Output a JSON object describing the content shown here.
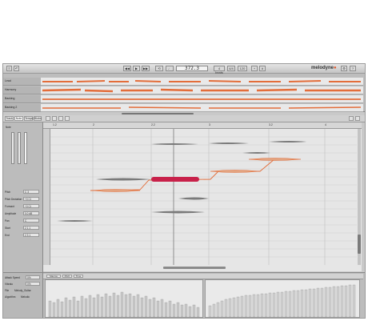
{
  "app": {
    "brand": "melodyne",
    "position": "372.3",
    "transport": {
      "rewind_label": "◀◀",
      "play_label": "▶",
      "forward_label": "▶▶"
    },
    "toolbar_buttons": [
      "4 beats",
      "4/4",
      "120"
    ]
  },
  "tracks": [
    {
      "name": "Lead"
    },
    {
      "name": "Harmony"
    },
    {
      "name": "Backing"
    },
    {
      "name": "Backing 2"
    }
  ],
  "tabs": [
    "Track",
    "Note",
    "Tempo",
    "Blobs"
  ],
  "inspector": {
    "section1": "Note",
    "fields": [
      {
        "label": "Pitch",
        "value": "C 3"
      },
      {
        "label": "Pitch Deviation",
        "value": "+0 Ct"
      },
      {
        "label": "Formant",
        "value": "+0 Ct"
      },
      {
        "label": "Amplitude",
        "value": "0.0 dB"
      },
      {
        "label": "Pan",
        "value": "C"
      },
      {
        "label": "Start",
        "value": "2 1 1"
      },
      {
        "label": "End",
        "value": "2 3 1"
      }
    ]
  },
  "ruler": [
    "1.2",
    "2",
    "2.2",
    "3",
    "3.2",
    "4"
  ],
  "bottom": {
    "labels": [
      "Macros",
      "Pitch",
      "Time"
    ],
    "left_fields": [
      {
        "label": "Attack Speed",
        "value": "0%"
      },
      {
        "label": "Vibrato",
        "value": "0%"
      },
      {
        "label": "File",
        "value": "Melody_Guitar"
      },
      {
        "label": "Algorithm",
        "value": "Melodic"
      }
    ]
  },
  "colors": {
    "accent": "#e36d3a",
    "selected_note": "#c8214a",
    "note_gray": "#6e6e6e"
  }
}
